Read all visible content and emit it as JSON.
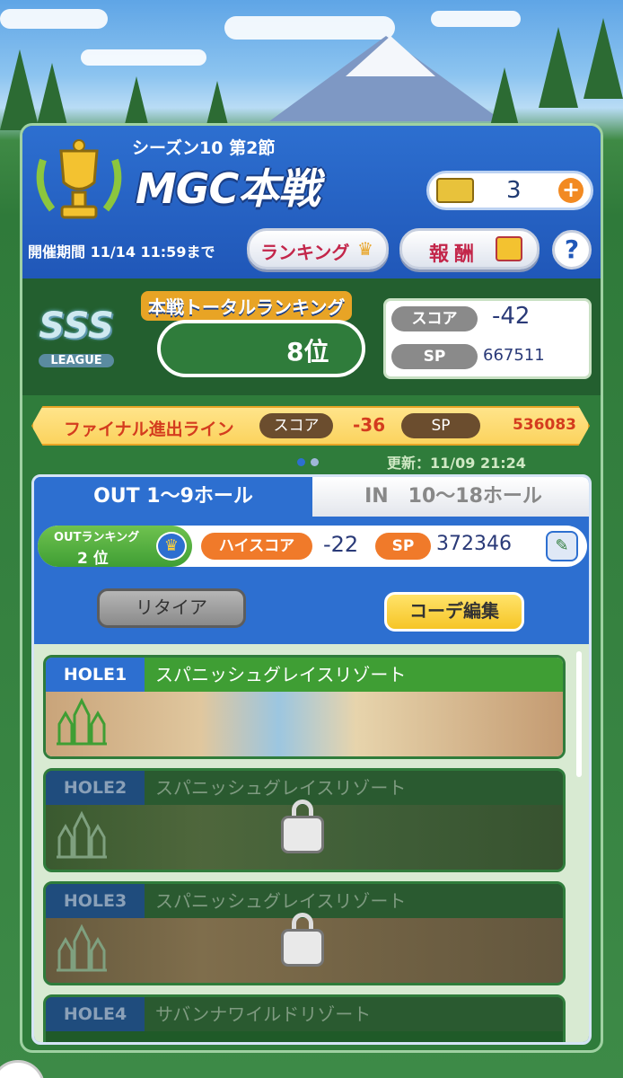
{
  "header": {
    "season": "シーズン10 第2節",
    "event_title": "MGC本戦",
    "ticket_count": "3",
    "period": "開催期間 11/14 11:59まで",
    "ranking_button": "ランキング",
    "reward_button": "報酬",
    "help_button": "?"
  },
  "total": {
    "label": "本戦トータルランキング",
    "rank": "8位",
    "score_label": "スコア",
    "score": "-42",
    "sp_label": "SP",
    "sp": "667511",
    "league_letters": "SSS",
    "league_name": "LEAGUE"
  },
  "final_line": {
    "label": "ファイナル進出ライン",
    "score_label": "スコア",
    "score": "-36",
    "sp_label": "SP",
    "sp": "536083"
  },
  "updated": "更新：11/09 21:24",
  "tabs": {
    "out": "OUT 1〜9ホール",
    "in": "IN　10〜18ホール"
  },
  "out_ranking": {
    "label": "OUTランキング",
    "rank": "2 位",
    "hiscore_label": "ハイスコア",
    "hiscore": "-22",
    "sp_label": "SP",
    "sp": "372346"
  },
  "buttons": {
    "retire": "リタイア",
    "coordinate": "コーデ編集"
  },
  "holes": [
    {
      "num": "HOLE1",
      "course": "スパニッシュグレイスリゾート",
      "locked": false
    },
    {
      "num": "HOLE2",
      "course": "スパニッシュグレイスリゾート",
      "locked": true
    },
    {
      "num": "HOLE3",
      "course": "スパニッシュグレイスリゾート",
      "locked": true
    },
    {
      "num": "HOLE4",
      "course": "サバンナワイルドリゾート",
      "locked": true
    }
  ],
  "colors": {
    "header_blue": "#2d6fd0",
    "panel_green": "#2f7c3b",
    "accent_orange": "#f07a2a",
    "final_red": "#d43c1e",
    "gold": "#e8a425"
  },
  "icons": {
    "trophy": "trophy-icon",
    "ticket": "ticket-icon",
    "plus": "plus-icon",
    "crown": "crown-icon",
    "gift": "gift-icon",
    "edit": "scorecard-edit-icon",
    "lock": "lock-icon",
    "emblem": "cathedral-emblem-icon"
  }
}
